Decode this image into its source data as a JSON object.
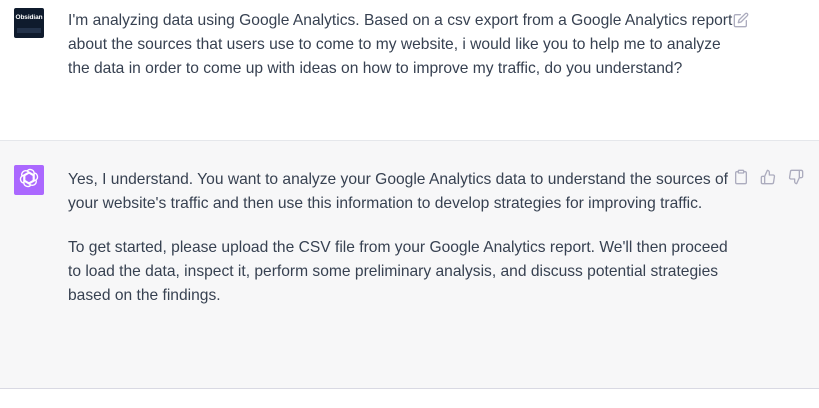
{
  "conversation": {
    "user_message": {
      "avatar_label": "Obsidian",
      "text": "I'm analyzing data using Google Analytics. Based on a csv export from a Google Analytics report about the sources that users use to come to my website, i would like you to help me to analyze the data in order to come up with ideas on how to improve my traffic, do you understand?",
      "edit_icon": "edit-icon"
    },
    "assistant_message": {
      "avatar_icon": "openai-logo-icon",
      "paragraphs": [
        "Yes, I understand. You want to analyze your Google Analytics data to understand the sources of your website's traffic and then use this information to develop strategies for improving traffic.",
        "To get started, please upload the CSV file from your Google Analytics report. We'll then proceed to load the data, inspect it, perform some preliminary analysis, and discuss potential strategies based on the findings."
      ],
      "action_icons": [
        "copy-icon",
        "thumbs-up-icon",
        "thumbs-down-icon"
      ]
    }
  },
  "colors": {
    "assistant_avatar_bg": "#ab68ff",
    "user_avatar_bg": "#0f1b2d",
    "assistant_row_bg": "#f7f7f8",
    "text": "#374151",
    "icon": "#acacbe"
  }
}
